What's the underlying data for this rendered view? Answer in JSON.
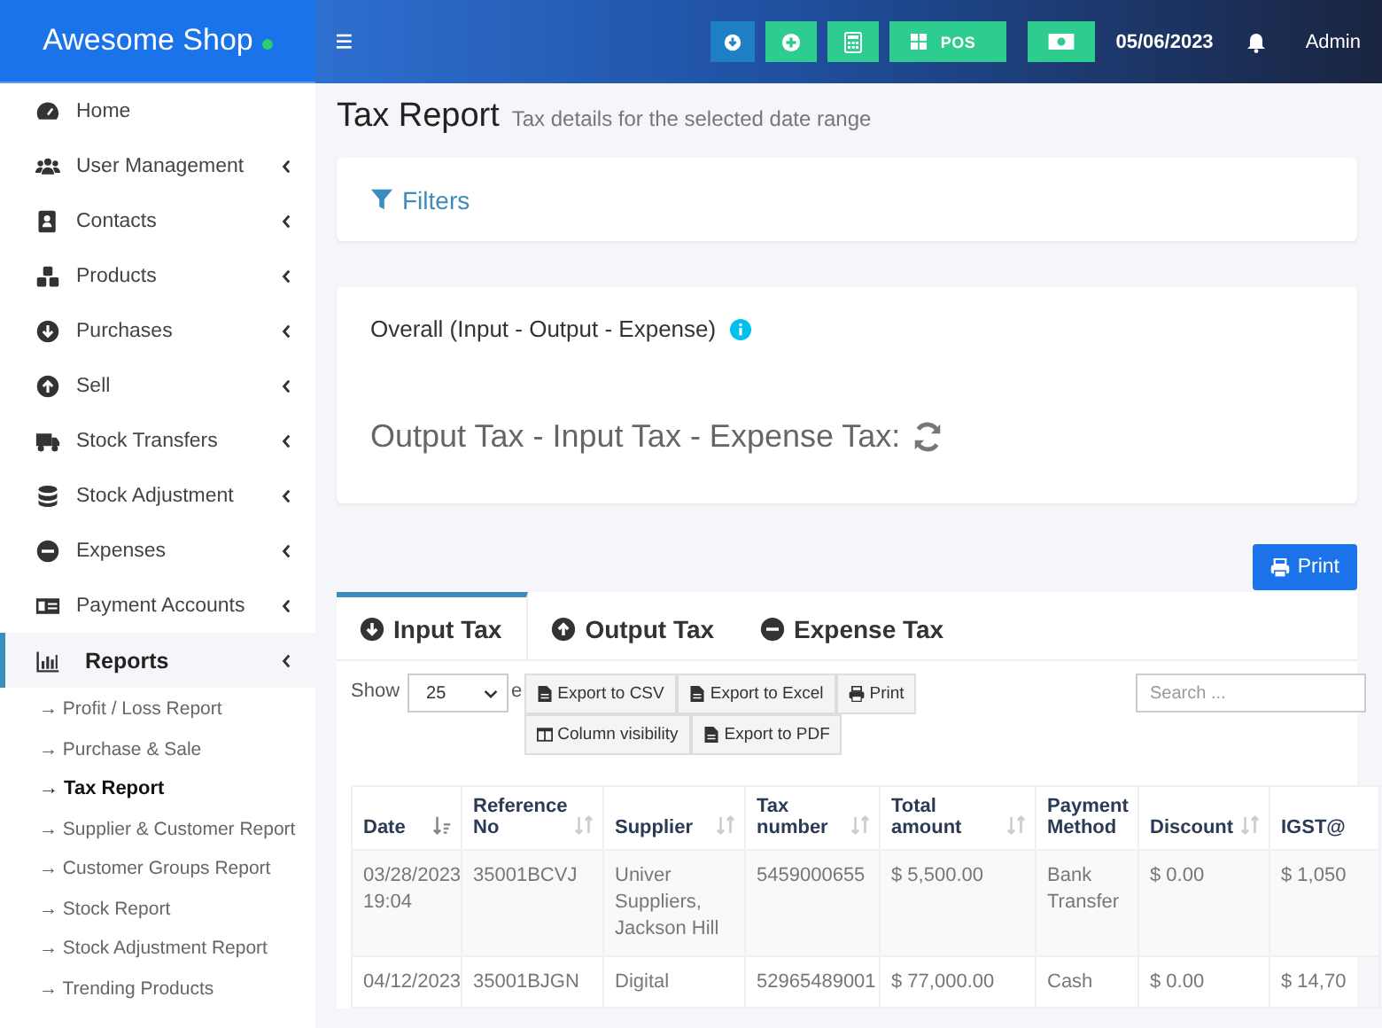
{
  "app": {
    "name": "Awesome Shop",
    "online": true
  },
  "topbar": {
    "buttons": [
      {
        "kind": "download"
      },
      {
        "kind": "add"
      },
      {
        "kind": "calculator"
      },
      {
        "kind": "pos",
        "label": "POS"
      },
      {
        "kind": "cash"
      }
    ],
    "date": "05/06/2023",
    "user": "Admin"
  },
  "sidebar": {
    "items": [
      {
        "label": "Home",
        "submenu": false,
        "selected": false
      },
      {
        "label": "User Management",
        "submenu": true,
        "selected": false
      },
      {
        "label": "Contacts",
        "submenu": true,
        "selected": false
      },
      {
        "label": "Products",
        "submenu": true,
        "selected": false
      },
      {
        "label": "Purchases",
        "submenu": true,
        "selected": false
      },
      {
        "label": "Sell",
        "submenu": true,
        "selected": false
      },
      {
        "label": "Stock Transfers",
        "submenu": true,
        "selected": false
      },
      {
        "label": "Stock Adjustment",
        "submenu": true,
        "selected": false
      },
      {
        "label": "Expenses",
        "submenu": true,
        "selected": false
      },
      {
        "label": "Payment Accounts",
        "submenu": true,
        "selected": false
      },
      {
        "label": "Reports",
        "submenu": true,
        "selected": true,
        "children": [
          {
            "label": "→ Profit / Loss Report",
            "selected": false
          },
          {
            "label": "→ Purchase & Sale",
            "selected": false
          },
          {
            "label": "→ Tax Report",
            "selected": true
          },
          {
            "label": "→ Supplier & Customer Report",
            "selected": false
          },
          {
            "label": "→ Customer Groups Report",
            "selected": false
          },
          {
            "label": "→ Stock Report",
            "selected": false
          },
          {
            "label": "→ Stock Adjustment Report",
            "selected": false
          },
          {
            "label": "→ Trending Products",
            "selected": false
          }
        ]
      }
    ]
  },
  "page": {
    "title": "Tax Report",
    "subtitle": "Tax details for the selected date range"
  },
  "filters": {
    "label": "Filters"
  },
  "overall": {
    "title": "Overall (Input - Output - Expense)",
    "formula": "Output Tax - Input Tax - Expense Tax:",
    "loading": true
  },
  "print_button": "Print",
  "tabs": [
    {
      "label": "Input Tax",
      "kind": "in",
      "selected": true
    },
    {
      "label": "Output Tax",
      "kind": "out",
      "selected": false
    },
    {
      "label": "Expense Tax",
      "kind": "expense",
      "selected": false
    }
  ],
  "table_controls": {
    "show_label": "Show",
    "page_length": "25",
    "entries_label": "e",
    "search_placeholder": "Search ...",
    "buttons": [
      {
        "label": "Export to CSV",
        "kind": "csv"
      },
      {
        "label": "Export to Excel",
        "kind": "excel"
      },
      {
        "label": "Print",
        "kind": "print"
      },
      {
        "label": "Column visibility",
        "kind": "columns"
      },
      {
        "label": "Export to PDF",
        "kind": "pdf"
      }
    ]
  },
  "table": {
    "columns": [
      {
        "label": "Date",
        "sortable": true,
        "sorted": true
      },
      {
        "label": "Reference No",
        "sortable": true,
        "sorted": false
      },
      {
        "label": "Supplier",
        "sortable": true,
        "sorted": false
      },
      {
        "label": "Tax number",
        "sortable": true,
        "sorted": false
      },
      {
        "label": "Total amount",
        "sortable": true,
        "sorted": false
      },
      {
        "label": "Payment Method",
        "sortable": false
      },
      {
        "label": "Discount",
        "sortable": true,
        "sorted": false
      },
      {
        "label": "IGST@",
        "sortable": false
      }
    ],
    "rows": [
      [
        "03/28/2023 19:04",
        "35001BCVJ",
        "Univer Suppliers, Jackson Hill",
        "5459000655",
        "$ 5,500.00",
        "Bank Transfer",
        "$ 0.00",
        "$ 1,050"
      ],
      [
        "04/12/2023",
        "35001BJGN",
        "Digital",
        "52965489001",
        "$ 77,000.00",
        "Cash",
        "$ 0.00",
        "$ 14,70"
      ]
    ]
  }
}
